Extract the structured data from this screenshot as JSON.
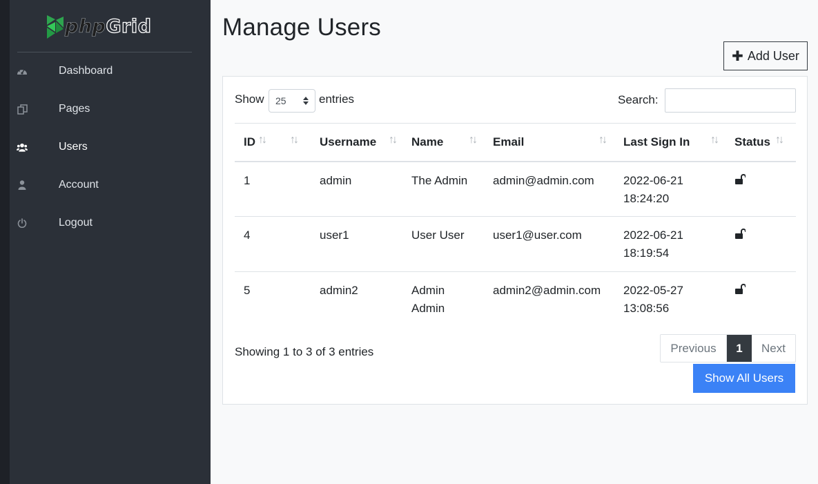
{
  "brand": {
    "part1": "php",
    "part2": "Grid"
  },
  "sidebar": {
    "items": [
      {
        "label": "Dashboard",
        "icon": "dashboard-gauge-icon"
      },
      {
        "label": "Pages",
        "icon": "pages-copy-icon"
      },
      {
        "label": "Users",
        "icon": "users-group-icon"
      },
      {
        "label": "Account",
        "icon": "account-user-icon"
      },
      {
        "label": "Logout",
        "icon": "power-icon"
      }
    ]
  },
  "header": {
    "title": "Manage Users",
    "add_user_label": "Add User"
  },
  "table_controls": {
    "show_label": "Show",
    "page_length": "25",
    "entries_label": "entries",
    "search_label": "Search:",
    "search_value": ""
  },
  "table": {
    "columns": [
      "ID",
      "",
      "Username",
      "Name",
      "Email",
      "Last Sign In",
      "Status"
    ],
    "rows": [
      {
        "id": "1",
        "username": "admin",
        "name": "The Admin",
        "email": "admin@admin.com",
        "date": "2022-06-21",
        "time": "18:24:20",
        "status_icon": "unlock-icon"
      },
      {
        "id": "4",
        "username": "user1",
        "name": "User User",
        "email": "user1@user.com",
        "date": "2022-06-21",
        "time": "18:19:54",
        "status_icon": "unlock-icon"
      },
      {
        "id": "5",
        "username": "admin2",
        "name": "Admin\nAdmin",
        "email": "admin2@admin.com",
        "date": "2022-05-27",
        "time": "13:08:56",
        "status_icon": "unlock-icon"
      }
    ]
  },
  "footer": {
    "info": "Showing 1 to 3 of 3 entries",
    "previous_label": "Previous",
    "current_page": "1",
    "next_label": "Next",
    "show_all_label": "Show All Users"
  },
  "colors": {
    "sidebar_bg": "#2b3038",
    "accent_blue": "#3b82f6",
    "active_page": "#343a40",
    "logo_green": "#2ea44f"
  }
}
